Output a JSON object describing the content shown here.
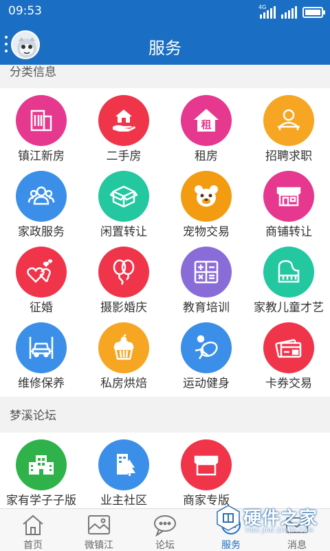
{
  "status_bar": {
    "time": "09:53",
    "network": "4G"
  },
  "header": {
    "title": "服务"
  },
  "sections": [
    {
      "title": "分类信息",
      "items": [
        {
          "label": "镇江新房",
          "icon": "building-icon",
          "color": "#e5388e"
        },
        {
          "label": "二手房",
          "icon": "house-hand-icon",
          "color": "#f0344a"
        },
        {
          "label": "租房",
          "icon": "rent-house-icon",
          "color": "#e5388e"
        },
        {
          "label": "招聘求职",
          "icon": "recruit-icon",
          "color": "#f6a623"
        },
        {
          "label": "家政服务",
          "icon": "people-icon",
          "color": "#3b8fe8"
        },
        {
          "label": "闲置转让",
          "icon": "box-icon",
          "color": "#23c7a0"
        },
        {
          "label": "宠物交易",
          "icon": "pet-icon",
          "color": "#f39c12"
        },
        {
          "label": "商铺转让",
          "icon": "shop-icon",
          "color": "#e5388e"
        },
        {
          "label": "征婚",
          "icon": "hearts-icon",
          "color": "#f0344a"
        },
        {
          "label": "摄影婚庆",
          "icon": "balloons-icon",
          "color": "#f0344a"
        },
        {
          "label": "教育培训",
          "icon": "calculator-icon",
          "color": "#8a6cd8"
        },
        {
          "label": "家教儿童才艺",
          "icon": "piano-icon",
          "color": "#23c7a0"
        },
        {
          "label": "维修保养",
          "icon": "car-lift-icon",
          "color": "#3b8fe8"
        },
        {
          "label": "私房烘焙",
          "icon": "cake-icon",
          "color": "#f6a623"
        },
        {
          "label": "运动健身",
          "icon": "running-icon",
          "color": "#3b8fe8"
        },
        {
          "label": "卡券交易",
          "icon": "card-icon",
          "color": "#f0344a"
        }
      ]
    },
    {
      "title": "梦溪论坛",
      "items": [
        {
          "label": "家有学子子版",
          "icon": "school-icon",
          "color": "#2fb24a"
        },
        {
          "label": "业主社区",
          "icon": "community-icon",
          "color": "#3b8fe8"
        },
        {
          "label": "商家专版",
          "icon": "store-icon",
          "color": "#f0344a"
        }
      ]
    }
  ],
  "bottom_nav": [
    {
      "label": "首页",
      "icon": "home-icon",
      "active": false
    },
    {
      "label": "微镇江",
      "icon": "image-icon",
      "active": false
    },
    {
      "label": "论坛",
      "icon": "chat-icon",
      "active": false
    },
    {
      "label": "服务",
      "icon": "service-icon",
      "active": true
    },
    {
      "label": "消息",
      "icon": "mail-icon",
      "active": false
    }
  ],
  "watermark": {
    "text": "硬件之家",
    "subtext": "YING JIAN ZHI JIA.COM"
  },
  "colors": {
    "primary": "#1a6fc4",
    "background": "#f2f2f2"
  }
}
